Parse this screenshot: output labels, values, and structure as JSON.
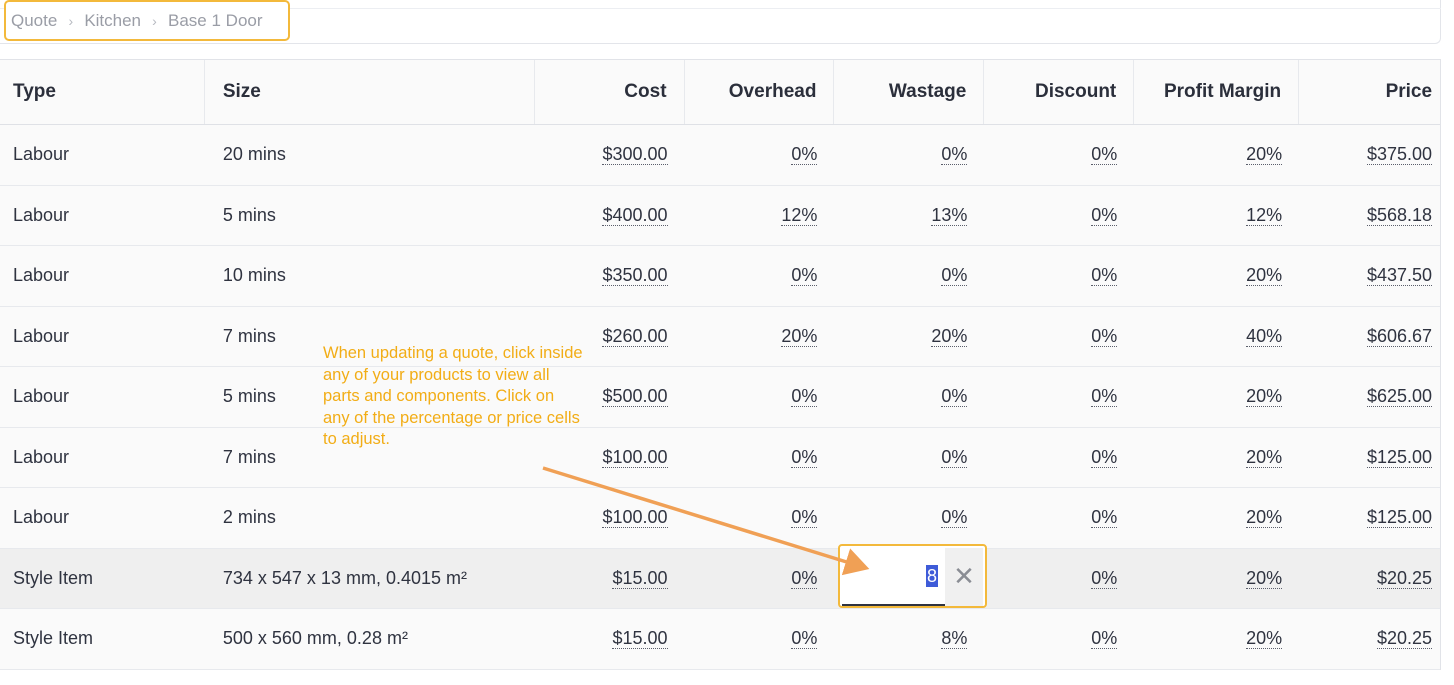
{
  "breadcrumb": {
    "items": [
      "Quote",
      "Kitchen",
      "Base 1 Door"
    ],
    "separator": "›"
  },
  "table": {
    "columns": {
      "type": "Type",
      "size": "Size",
      "cost": "Cost",
      "overhead": "Overhead",
      "wastage": "Wastage",
      "discount": "Discount",
      "profit": "Profit Margin",
      "price": "Price"
    },
    "rows": [
      {
        "type": "Labour",
        "size": "20 mins",
        "cost": "$300.00",
        "overhead": "0%",
        "wastage": "0%",
        "discount": "0%",
        "profit": "20%",
        "price": "$375.00"
      },
      {
        "type": "Labour",
        "size": "5 mins",
        "cost": "$400.00",
        "overhead": "12%",
        "wastage": "13%",
        "discount": "0%",
        "profit": "12%",
        "price": "$568.18"
      },
      {
        "type": "Labour",
        "size": "10 mins",
        "cost": "$350.00",
        "overhead": "0%",
        "wastage": "0%",
        "discount": "0%",
        "profit": "20%",
        "price": "$437.50"
      },
      {
        "type": "Labour",
        "size": "7 mins",
        "cost": "$260.00",
        "overhead": "20%",
        "wastage": "20%",
        "discount": "0%",
        "profit": "40%",
        "price": "$606.67"
      },
      {
        "type": "Labour",
        "size": "5 mins",
        "cost": "$500.00",
        "overhead": "0%",
        "wastage": "0%",
        "discount": "0%",
        "profit": "20%",
        "price": "$625.00"
      },
      {
        "type": "Labour",
        "size": "7 mins",
        "cost": "$100.00",
        "overhead": "0%",
        "wastage": "0%",
        "discount": "0%",
        "profit": "20%",
        "price": "$125.00"
      },
      {
        "type": "Labour",
        "size": "2 mins",
        "cost": "$100.00",
        "overhead": "0%",
        "wastage": "0%",
        "discount": "0%",
        "profit": "20%",
        "price": "$125.00"
      },
      {
        "type": "Style Item",
        "size": "734 x 547 x 13 mm, 0.4015 m²",
        "cost": "$15.00",
        "overhead": "0%",
        "wastage": "",
        "discount": "0%",
        "profit": "20%",
        "price": "$20.25"
      },
      {
        "type": "Style Item",
        "size": "500 x 560 mm, 0.28 m²",
        "cost": "$15.00",
        "overhead": "0%",
        "wastage": "8%",
        "discount": "0%",
        "profit": "20%",
        "price": "$20.25"
      }
    ],
    "editing": {
      "row_index": 7,
      "column": "wastage",
      "value": "8",
      "clear_icon": "close-icon"
    }
  },
  "annotation": {
    "text": "When updating a quote, click inside any of your products to view all parts and components. Click on any of the percentage or price cells to adjust.",
    "color": "#f2ad16"
  },
  "colors": {
    "highlight": "#f3b93b",
    "selection": "#3e5bd8",
    "arrow": "#f0a055"
  }
}
